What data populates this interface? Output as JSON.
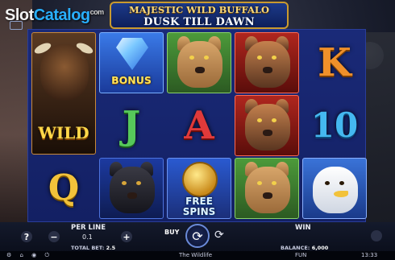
{
  "watermark": {
    "part1": "Slot",
    "part2": "Catalog",
    "part3": "com"
  },
  "title": {
    "line1": "MAJESTIC WILD BUFFALO",
    "line2": "DUSK TILL DAWN"
  },
  "symbols": {
    "wild": "WILD",
    "bonus": "BONUS",
    "free_spins_l1": "FREE",
    "free_spins_l2": "SPINS",
    "k": "K",
    "j": "J",
    "a": "A",
    "ten": "10",
    "q": "Q"
  },
  "controls": {
    "help": "?",
    "minus": "−",
    "plus": "+",
    "per_line_label": "PER LINE",
    "per_line_value": "0.1",
    "total_bet_label": "TOTAL BET:",
    "total_bet_value": "2.5",
    "buy": "BUY",
    "spin_icon": "⟳",
    "autoplay_icon": "⟳",
    "win_label": "WIN",
    "balance_label": "BALANCE:",
    "balance_value": "6,000"
  },
  "status": {
    "icons": "⚙ ⌂ ◉ ⏻",
    "studio": "The Wildlife",
    "mode": "FUN",
    "time": "13:33"
  },
  "colors": {
    "reel_bg": "#1a2a78",
    "gold": "#c99a2e",
    "accent": "#29b0ff"
  }
}
